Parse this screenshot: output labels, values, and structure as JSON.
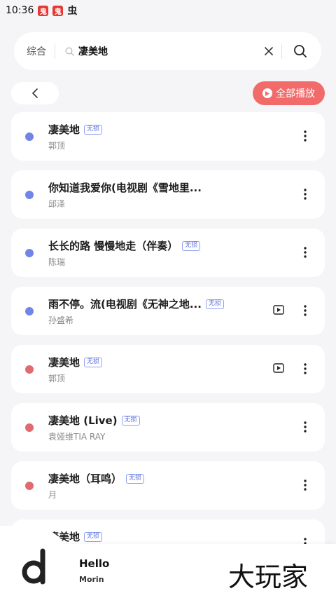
{
  "status_bar": {
    "time": "10:36",
    "icons": [
      "app-badge-icon",
      "app-badge-icon",
      "bug-icon"
    ]
  },
  "search": {
    "scope_label": "综合",
    "query": "凄美地"
  },
  "toolbar": {
    "play_all_label": "全部播放"
  },
  "colors": {
    "accent": "#f26b6b",
    "dot_blue": "#6f86e6",
    "dot_red": "#e06a6e"
  },
  "songs": [
    {
      "title": "凄美地",
      "tag": "无损",
      "artist": "郭顶",
      "dot": "blue",
      "mv": false
    },
    {
      "title": "你知道我爱你(电视剧《雪地里...",
      "tag": "",
      "artist": "邱泽",
      "dot": "blue",
      "mv": false
    },
    {
      "title": "长长的路 慢慢地走（伴奏）",
      "tag": "无损",
      "artist": "陈瑞",
      "dot": "blue",
      "mv": false
    },
    {
      "title": "雨不停。流(电视剧《无神之地...",
      "tag": "无损",
      "artist": "孙盛希",
      "dot": "blue",
      "mv": true
    },
    {
      "title": "凄美地",
      "tag": "无损",
      "artist": "郭顶",
      "dot": "red",
      "mv": true
    },
    {
      "title": "凄美地 (Live)",
      "tag": "无损",
      "artist": "袁娅维TIA RAY",
      "dot": "red",
      "mv": false
    },
    {
      "title": "凄美地（耳鸣）",
      "tag": "无损",
      "artist": "月",
      "dot": "red",
      "mv": false
    },
    {
      "title": "凄美地",
      "tag": "无损",
      "artist": "",
      "dot": "red",
      "mv": false
    }
  ],
  "player": {
    "title": "Hello",
    "artist": "Morin",
    "watermark": "大玩家"
  }
}
